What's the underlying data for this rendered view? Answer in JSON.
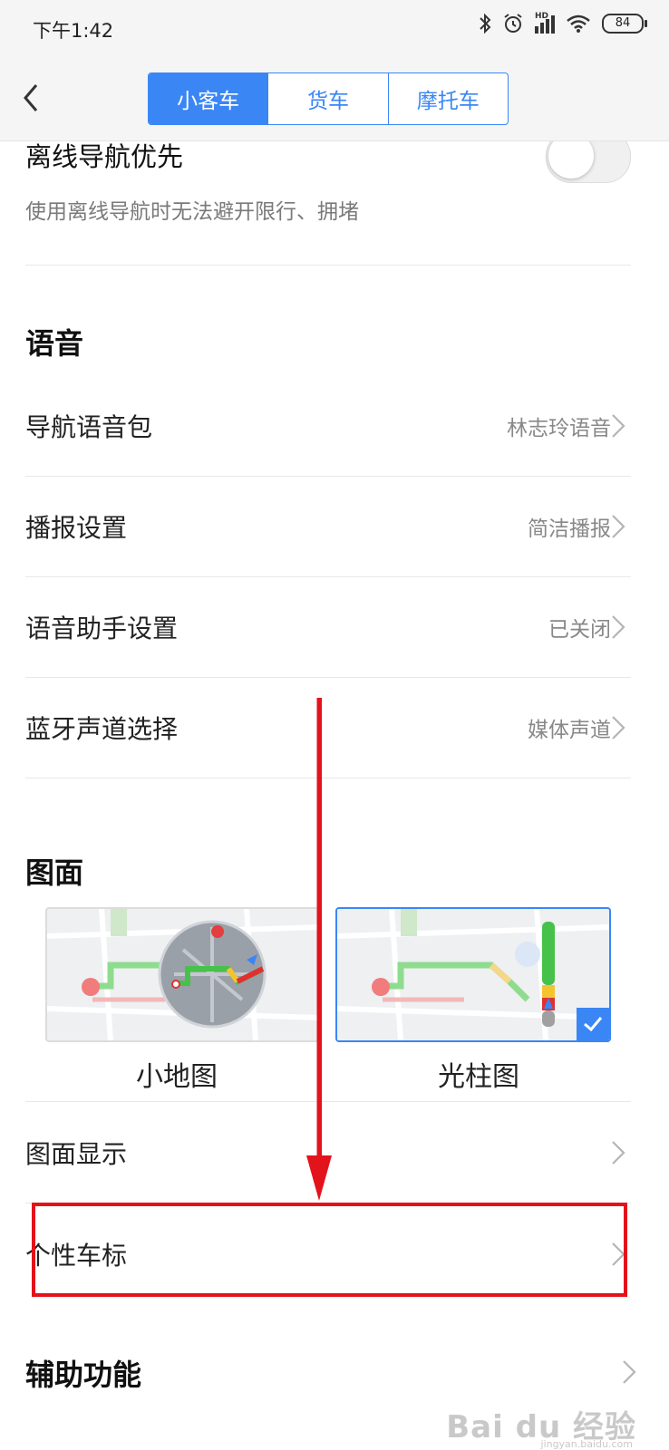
{
  "status_bar": {
    "time": "下午1:42",
    "battery": "84",
    "network_label": "HD"
  },
  "header": {
    "tabs": [
      "小客车",
      "货车",
      "摩托车"
    ],
    "active_tab": 0
  },
  "offline_nav": {
    "title": "离线导航优先",
    "description": "使用离线导航时无法避开限行、拥堵",
    "enabled": false
  },
  "voice_section": {
    "title": "语音",
    "rows": [
      {
        "label": "导航语音包",
        "value": "林志玲语音"
      },
      {
        "label": "播报设置",
        "value": "简洁播报"
      },
      {
        "label": "语音助手设置",
        "value": "已关闭"
      },
      {
        "label": "蓝牙声道选择",
        "value": "媒体声道"
      }
    ]
  },
  "display_section": {
    "title": "图面",
    "options": [
      {
        "label": "小地图",
        "selected": false
      },
      {
        "label": "光柱图",
        "selected": true
      }
    ],
    "rows": [
      {
        "label": "图面显示"
      },
      {
        "label": "个性车标"
      }
    ]
  },
  "assist_section": {
    "title": "辅助功能"
  },
  "watermark": {
    "text": "Bai du 经验",
    "sub": "jingyan.baidu.com"
  },
  "colors": {
    "accent": "#3a86f5",
    "annotation": "#e3131b"
  }
}
